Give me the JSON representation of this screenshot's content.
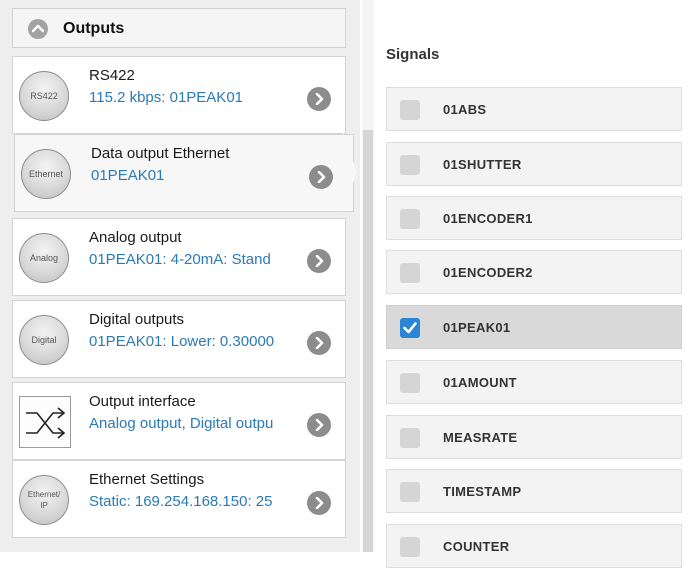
{
  "outputs": {
    "title": "Outputs",
    "items": [
      {
        "badge": "RS422",
        "name": "RS422",
        "value": "115.2 kbps: 01PEAK01"
      },
      {
        "badge": "Ethernet",
        "name": "Data output Ethernet",
        "value": "01PEAK01"
      },
      {
        "badge": "Analog",
        "name": "Analog output",
        "value": "01PEAK01: 4-20mA: Stand"
      },
      {
        "badge": "Digital",
        "name": "Digital outputs",
        "value": "01PEAK01: Lower: 0.30000"
      },
      {
        "badge": "",
        "name": "Output interface",
        "value": "Analog output, Digital outpu"
      },
      {
        "badge": "Ethernet/ IP",
        "name": "Ethernet Settings",
        "value": "Static: 169.254.168.150: 25"
      }
    ]
  },
  "signals": {
    "title": "Signals",
    "items": [
      {
        "label": "01ABS",
        "checked": false
      },
      {
        "label": "01SHUTTER",
        "checked": false
      },
      {
        "label": "01ENCODER1",
        "checked": false
      },
      {
        "label": "01ENCODER2",
        "checked": false
      },
      {
        "label": "01PEAK01",
        "checked": true
      },
      {
        "label": "01AMOUNT",
        "checked": false
      },
      {
        "label": "MEASRATE",
        "checked": false
      },
      {
        "label": "TIMESTAMP",
        "checked": false
      },
      {
        "label": "COUNTER",
        "checked": false
      }
    ]
  },
  "colors": {
    "value_text": "#2a7ab8",
    "checkbox_checked": "#2b84d4"
  }
}
